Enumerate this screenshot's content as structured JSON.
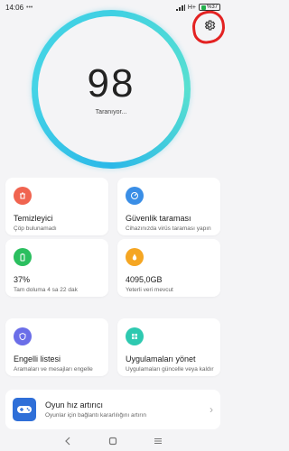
{
  "status_bar": {
    "time": "14:06",
    "network": "H+",
    "battery": "%37"
  },
  "score": {
    "value": "98",
    "label": "Taranıyor..."
  },
  "cards": [
    {
      "title": "Temizleyici",
      "subtitle": "Çöp bulunamadı",
      "color": "#f06450",
      "icon": "trash-icon"
    },
    {
      "title": "Güvenlik taraması",
      "subtitle": "Cihazınızda virüs taraması yapın",
      "color": "#3a8ee6",
      "icon": "gauge-icon"
    },
    {
      "title": "37%",
      "subtitle": "Tam doluma 4 sa 22 dak",
      "color": "#2bbf5f",
      "icon": "battery-icon"
    },
    {
      "title": "4095,0GB",
      "subtitle": "Yeterli veri mevcut",
      "color": "#f5a623",
      "icon": "droplet-icon"
    },
    {
      "title": "Engelli listesi",
      "subtitle": "Aramaları ve mesajları engelle",
      "color": "#6b6ee8",
      "icon": "shield-icon"
    },
    {
      "title": "Uygulamaları yönet",
      "subtitle": "Uygulamaları güncelle veya kaldır",
      "color": "#2ec9b0",
      "icon": "grid-icon"
    }
  ],
  "wide_card": {
    "title": "Oyun hız artırıcı",
    "subtitle": "Oyunlar için bağlantı kararlılığını artırın",
    "icon": "gamepad-icon"
  },
  "colors": {
    "ring": "#3fd0e3",
    "annotation": "#e32222",
    "background": "#f4f4f6"
  }
}
